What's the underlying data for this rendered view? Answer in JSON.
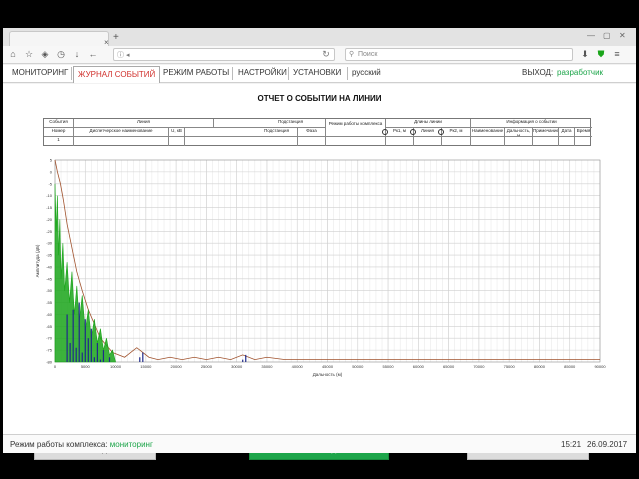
{
  "browser": {
    "tab_close": "×",
    "tab_new": "+",
    "url_info": "ⓘ ◂",
    "search_placeholder": "Поиск"
  },
  "menu": {
    "items": [
      "МОНИТОРИНГ",
      "ЖУРНАЛ СОБЫТИЙ",
      "РЕЖИМ РАБОТЫ",
      "НАСТРОЙКИ",
      "УСТАНОВКИ",
      "русский"
    ],
    "active_index": 1,
    "exit_label": "ВЫХОД:",
    "user": "разработчик"
  },
  "report": {
    "title": "ОТЧЕТ О СОБЫТИИ НА ЛИНИИ",
    "table": {
      "events": "События",
      "line": "Линия",
      "substation": "Подстанция",
      "mode": "Режим работы комплекса",
      "lengths": "Длины линии",
      "info": "Информация о событии",
      "number": "Номер",
      "dispatch_name": "Диспетчерское наименование",
      "voltage": "U, кВ",
      "substation_sub": "Подстанция",
      "phase": "Фаза",
      "pk1": "Рк1, м",
      "line_len": "Линия",
      "pk2": "Рк2, м",
      "name": "Наименование",
      "distance": "Дальность, м",
      "note": "Примечание",
      "date": "Дата",
      "time": "Время",
      "row_number": "1"
    }
  },
  "chart_data": {
    "type": "line",
    "xlabel": "Дальность (м)",
    "ylabel": "Амплитуда (дБ)",
    "xlim": [
      0,
      90000
    ],
    "ylim": [
      -80,
      5
    ],
    "x_ticks": [
      0,
      5000,
      10000,
      15000,
      20000,
      25000,
      30000,
      35000,
      40000,
      45000,
      50000,
      55000,
      60000,
      65000,
      70000,
      75000,
      80000,
      85000,
      90000
    ],
    "y_ticks": [
      5,
      0,
      -5,
      -10,
      -15,
      -20,
      -25,
      -30,
      -35,
      -40,
      -45,
      -50,
      -55,
      -60,
      -65,
      -70,
      -75,
      -80
    ],
    "grid": true,
    "series": [
      {
        "color": "#a0522d",
        "x": [
          0,
          400,
          900,
          1400,
          2000,
          2800,
          3600,
          4500,
          5500,
          6500,
          7500,
          8500,
          9500,
          10500,
          11500,
          12500,
          13500,
          14500,
          15500,
          17000,
          19000,
          21000,
          23000,
          25000,
          27000,
          29000,
          31000,
          33000,
          35000,
          38000,
          42000,
          46000,
          50000,
          55000,
          60000,
          65000,
          70000,
          75000,
          80000,
          85000,
          90000
        ],
        "y": [
          5,
          0,
          -5,
          -12,
          -22,
          -32,
          -42,
          -50,
          -58,
          -64,
          -70,
          -73,
          -76,
          -77,
          -78,
          -76,
          -74,
          -76,
          -78,
          -79,
          -78,
          -79,
          -78,
          -79,
          -78,
          -79,
          -77,
          -79,
          -78,
          -79,
          -79,
          -79,
          -79,
          -79,
          -79,
          -79,
          -79,
          -79,
          -79,
          -79,
          -79
        ]
      },
      {
        "color": "#1aa51a",
        "x": [
          0,
          200,
          400,
          600,
          800,
          1000,
          1300,
          1600,
          2000,
          2400,
          2800,
          3200,
          3600,
          4000,
          4500,
          5000,
          5500,
          6000,
          6500,
          7000,
          7500,
          8000,
          8500,
          9000,
          9500,
          10000
        ],
        "y": [
          -5,
          -25,
          -10,
          -35,
          -20,
          -45,
          -30,
          -50,
          -38,
          -55,
          -42,
          -60,
          -48,
          -63,
          -52,
          -67,
          -58,
          -70,
          -62,
          -72,
          -66,
          -75,
          -70,
          -77,
          -75,
          -80
        ]
      },
      {
        "color": "#1f2a8a",
        "x": [
          2000,
          2500,
          3000,
          3500,
          4000,
          4500,
          5000,
          5500,
          6000,
          6500,
          7000,
          7500,
          8000,
          8500,
          9000,
          14000,
          14500,
          15000,
          31000,
          31500
        ],
        "y": [
          -60,
          -72,
          -58,
          -74,
          -55,
          -76,
          -62,
          -70,
          -66,
          -78,
          -72,
          -79,
          -75,
          -80,
          -78,
          -78,
          -76,
          -80,
          -79,
          -77
        ]
      }
    ]
  },
  "buttons": {
    "back": "НАЗАД",
    "graphs": "ВКЛЮЧИТЬ ГРАФИКИ ДЛЯ ОТЧЕТОВ",
    "print": "ПЕЧАТЬ"
  },
  "status": {
    "mode_label": "Режим работы комплекса:",
    "mode_value": "мониторинг",
    "time": "15:21",
    "date": "26.09.2017"
  }
}
